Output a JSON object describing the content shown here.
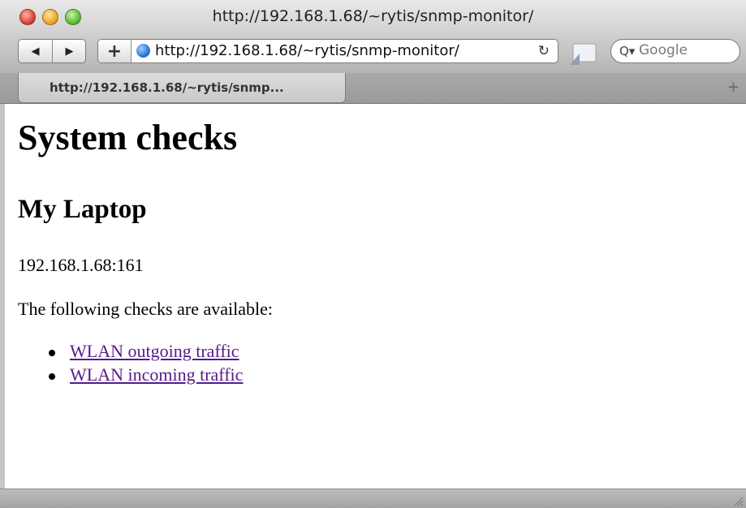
{
  "window": {
    "title": "http://192.168.1.68/~rytis/snmp-monitor/"
  },
  "toolbar": {
    "back_icon": "◀",
    "forward_icon": "▶",
    "add_bookmark_icon": "+",
    "address_url": "http://192.168.1.68/~rytis/snmp-monitor/",
    "reload_icon": "↻",
    "search_icon": "Q▾",
    "search_placeholder": "Google"
  },
  "tabs": [
    {
      "label": "http://192.168.1.68/~rytis/snmp..."
    }
  ],
  "tabbar": {
    "new_tab_icon": "+"
  },
  "page": {
    "heading": "System checks",
    "host_name": "My Laptop",
    "host_address": "192.168.1.68:161",
    "intro": "The following checks are available:",
    "checks": [
      {
        "label": "WLAN outgoing traffic"
      },
      {
        "label": "WLAN incoming traffic"
      }
    ]
  },
  "colors": {
    "visited_link": "#551a8b"
  }
}
